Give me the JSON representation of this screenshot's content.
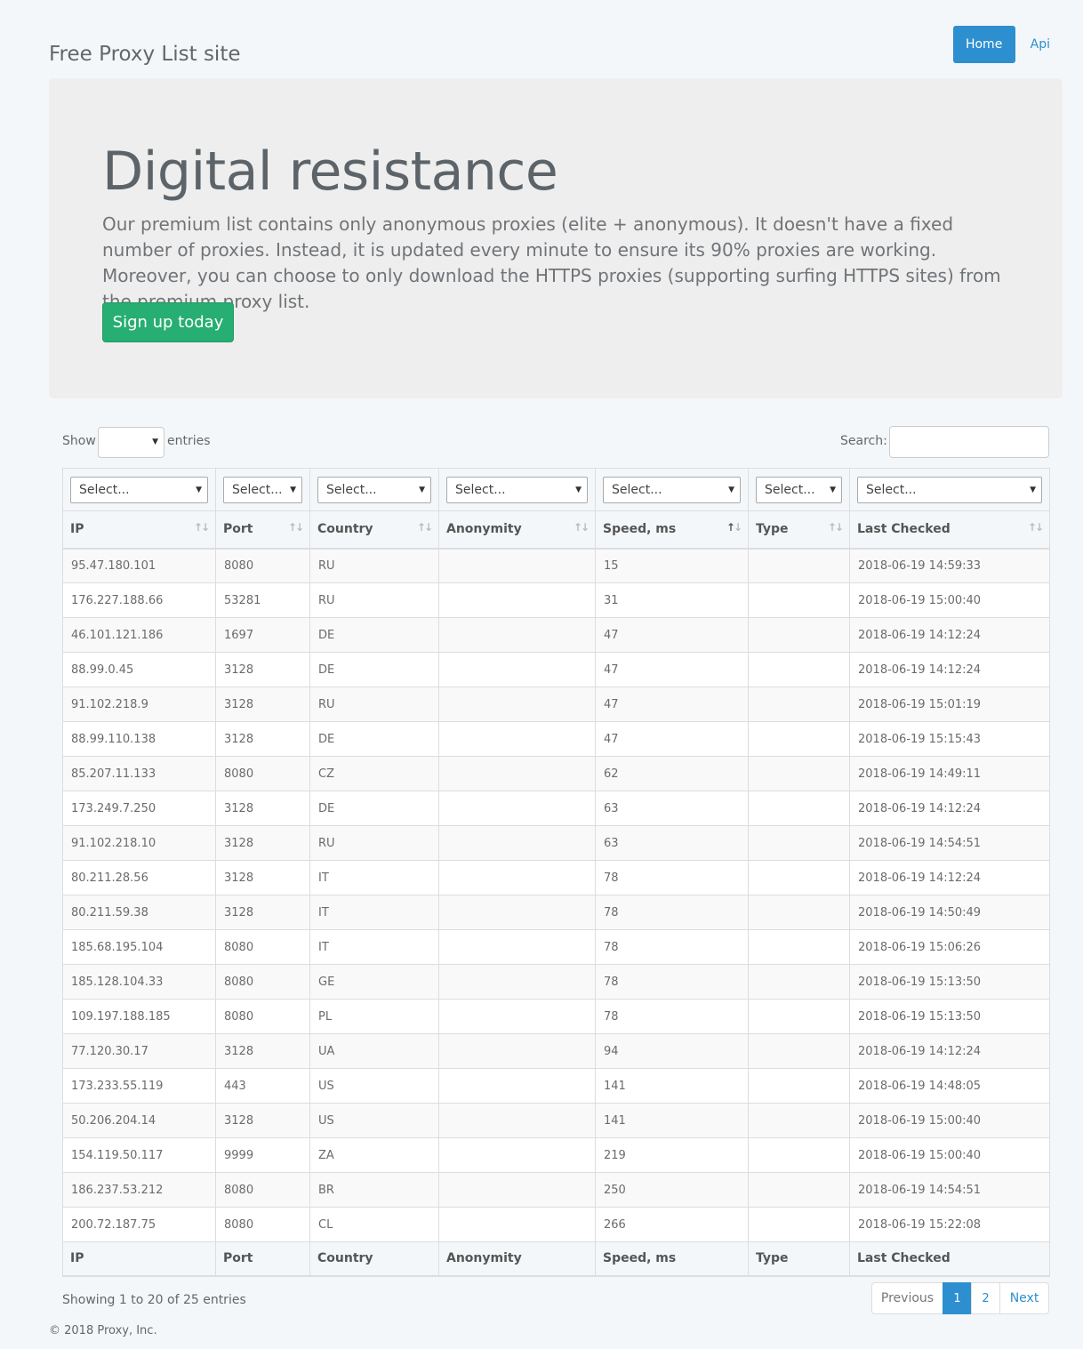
{
  "header": {
    "site_title": "Free Proxy List site"
  },
  "nav": {
    "home": "Home",
    "api": "Api"
  },
  "jumbotron": {
    "title": "Digital resistance",
    "text": "Our premium list contains only anonymous proxies (elite + anonymous). It doesn't have a fixed number of proxies. Instead, it is updated every minute to ensure its 90% proxies are working. Moreover, you can choose to only download the HTTPS proxies (supporting surfing HTTPS sites) from the premium proxy list.",
    "button": "Sign up today"
  },
  "controls": {
    "show_label": "Show",
    "entries_label": "entries",
    "search_label": "Search:",
    "show_value": "",
    "search_value": ""
  },
  "filters": [
    "Select...",
    "Select...",
    "Select...",
    "Select...",
    "Select...",
    "Select...",
    "Select..."
  ],
  "columns": [
    "IP",
    "Port",
    "Country",
    "Anonymity",
    "Speed, ms",
    "Type",
    "Last Checked"
  ],
  "sort_column": "Speed, ms",
  "rows": [
    [
      "95.47.180.101",
      "8080",
      "RU",
      "",
      "15",
      "",
      "2018-06-19 14:59:33"
    ],
    [
      "176.227.188.66",
      "53281",
      "RU",
      "",
      "31",
      "",
      "2018-06-19 15:00:40"
    ],
    [
      "46.101.121.186",
      "1697",
      "DE",
      "",
      "47",
      "",
      "2018-06-19 14:12:24"
    ],
    [
      "88.99.0.45",
      "3128",
      "DE",
      "",
      "47",
      "",
      "2018-06-19 14:12:24"
    ],
    [
      "91.102.218.9",
      "3128",
      "RU",
      "",
      "47",
      "",
      "2018-06-19 15:01:19"
    ],
    [
      "88.99.110.138",
      "3128",
      "DE",
      "",
      "47",
      "",
      "2018-06-19 15:15:43"
    ],
    [
      "85.207.11.133",
      "8080",
      "CZ",
      "",
      "62",
      "",
      "2018-06-19 14:49:11"
    ],
    [
      "173.249.7.250",
      "3128",
      "DE",
      "",
      "63",
      "",
      "2018-06-19 14:12:24"
    ],
    [
      "91.102.218.10",
      "3128",
      "RU",
      "",
      "63",
      "",
      "2018-06-19 14:54:51"
    ],
    [
      "80.211.28.56",
      "3128",
      "IT",
      "",
      "78",
      "",
      "2018-06-19 14:12:24"
    ],
    [
      "80.211.59.38",
      "3128",
      "IT",
      "",
      "78",
      "",
      "2018-06-19 14:50:49"
    ],
    [
      "185.68.195.104",
      "8080",
      "IT",
      "",
      "78",
      "",
      "2018-06-19 15:06:26"
    ],
    [
      "185.128.104.33",
      "8080",
      "GE",
      "",
      "78",
      "",
      "2018-06-19 15:13:50"
    ],
    [
      "109.197.188.185",
      "8080",
      "PL",
      "",
      "78",
      "",
      "2018-06-19 15:13:50"
    ],
    [
      "77.120.30.17",
      "3128",
      "UA",
      "",
      "94",
      "",
      "2018-06-19 14:12:24"
    ],
    [
      "173.233.55.119",
      "443",
      "US",
      "",
      "141",
      "",
      "2018-06-19 14:48:05"
    ],
    [
      "50.206.204.14",
      "3128",
      "US",
      "",
      "141",
      "",
      "2018-06-19 15:00:40"
    ],
    [
      "154.119.50.117",
      "9999",
      "ZA",
      "",
      "219",
      "",
      "2018-06-19 15:00:40"
    ],
    [
      "186.237.53.212",
      "8080",
      "BR",
      "",
      "250",
      "",
      "2018-06-19 14:54:51"
    ],
    [
      "200.72.187.75",
      "8080",
      "CL",
      "",
      "266",
      "",
      "2018-06-19 15:22:08"
    ]
  ],
  "info": "Showing 1 to 20 of 25 entries",
  "pagination": {
    "previous": "Previous",
    "pages": [
      "1",
      "2"
    ],
    "current": "1",
    "next": "Next"
  },
  "footer": {
    "copyright": "© 2018 Proxy, Inc."
  },
  "colors": {
    "primary": "#2d8fcf",
    "success": "#27ae72",
    "background": "#f4f7fa",
    "jumbotron": "#eeeeee"
  }
}
